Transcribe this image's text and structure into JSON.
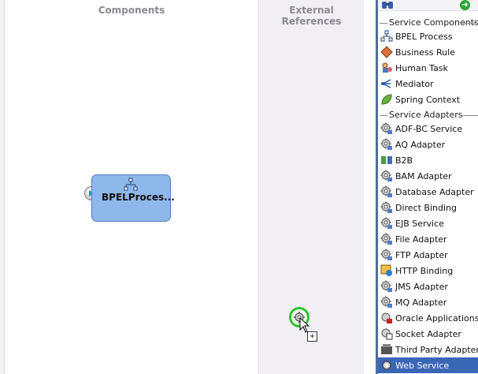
{
  "canvas": {
    "components_title": "Components",
    "external_references_title": "External References",
    "bpel_component": {
      "label": "BPELProces..."
    }
  },
  "palette": {
    "sections": [
      {
        "title": "Service Components",
        "items": [
          {
            "label": "BPEL Process",
            "icon": "bpel-process-icon"
          },
          {
            "label": "Business Rule",
            "icon": "business-rule-icon"
          },
          {
            "label": "Human Task",
            "icon": "human-task-icon"
          },
          {
            "label": "Mediator",
            "icon": "mediator-icon"
          },
          {
            "label": "Spring Context",
            "icon": "spring-context-icon"
          }
        ]
      },
      {
        "title": "Service Adapters",
        "items": [
          {
            "label": "ADF-BC Service",
            "icon": "adf-bc-service-icon"
          },
          {
            "label": "AQ Adapter",
            "icon": "aq-adapter-icon"
          },
          {
            "label": "B2B",
            "icon": "b2b-icon"
          },
          {
            "label": "BAM Adapter",
            "icon": "bam-adapter-icon"
          },
          {
            "label": "Database Adapter",
            "icon": "database-adapter-icon"
          },
          {
            "label": "Direct Binding",
            "icon": "direct-binding-icon"
          },
          {
            "label": "EJB Service",
            "icon": "ejb-service-icon"
          },
          {
            "label": "File Adapter",
            "icon": "file-adapter-icon"
          },
          {
            "label": "FTP Adapter",
            "icon": "ftp-adapter-icon"
          },
          {
            "label": "HTTP Binding",
            "icon": "http-binding-icon"
          },
          {
            "label": "JMS Adapter",
            "icon": "jms-adapter-icon"
          },
          {
            "label": "MQ Adapter",
            "icon": "mq-adapter-icon"
          },
          {
            "label": "Oracle Applications",
            "icon": "oracle-applications-icon"
          },
          {
            "label": "Socket Adapter",
            "icon": "socket-adapter-icon"
          },
          {
            "label": "Third Party Adapter",
            "icon": "third-party-adapter-icon"
          },
          {
            "label": "Web Service",
            "icon": "web-service-icon",
            "selected": true
          }
        ]
      }
    ]
  },
  "colors": {
    "selection": "#3a66b6",
    "component_fill": "#8fb8ea",
    "external_refs_bg": "#f1eff4",
    "drop_indicator": "#2ec42e"
  }
}
